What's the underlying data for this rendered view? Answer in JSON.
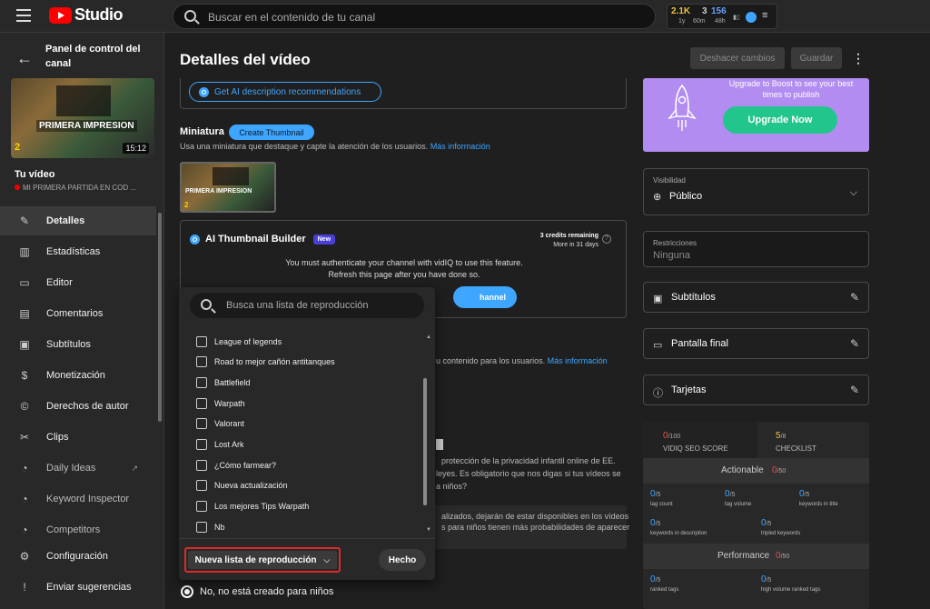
{
  "topbar": {
    "logo_text": "Studio",
    "search_placeholder": "Buscar en el contenido de tu canal",
    "vidiq": {
      "stat1_value": "2.1K",
      "stat1_sub": "1y",
      "stat2_value": "3",
      "stat2_sub": "60m",
      "stat3_value": "156",
      "stat3_sub": "48h"
    }
  },
  "sidebar": {
    "panel_title": "Panel de control del canal",
    "thumbnail": {
      "caption": "PRIMERA IMPRESION",
      "number": "2",
      "duration": "15:12"
    },
    "your_video_label": "Tu vídeo",
    "video_name": "MI PRIMERA PARTIDA EN COD ...",
    "items": [
      {
        "label": "Detalles",
        "icon": "pencil-icon"
      },
      {
        "label": "Estadísticas",
        "icon": "analytics-icon"
      },
      {
        "label": "Editor",
        "icon": "film-editor-icon"
      },
      {
        "label": "Comentarios",
        "icon": "comment-icon"
      },
      {
        "label": "Subtítulos",
        "icon": "subtitles-icon"
      },
      {
        "label": "Monetización",
        "icon": "dollar-icon"
      },
      {
        "label": "Derechos de autor",
        "icon": "copyright-icon"
      },
      {
        "label": "Clips",
        "icon": "scissors-icon"
      },
      {
        "label": "Daily Ideas",
        "icon": "vidiq-icon"
      },
      {
        "label": "Keyword Inspector",
        "icon": "vidiq-icon"
      },
      {
        "label": "Competitors",
        "icon": "vidiq-icon"
      },
      {
        "label": "Configuración",
        "icon": "gear-icon"
      },
      {
        "label": "Enviar sugerencias",
        "icon": "feedback-icon"
      }
    ]
  },
  "header": {
    "title": "Detalles del vídeo",
    "undo_label": "Deshacer cambios",
    "save_label": "Guardar"
  },
  "main": {
    "ai_description_button": "Get AI description recommendations",
    "miniatura_label": "Miniatura",
    "create_thumbnail_label": "Create Thumbnail",
    "miniatura_desc": "Usa una miniatura que destaque y capte la atención de los usuarios.",
    "more_info": "Más información",
    "thumb_caption": "PRIMERA IMPRESION",
    "thumb_number": "2",
    "builder": {
      "title": "AI Thumbnail Builder",
      "badge": "New",
      "credits_line1": "3 credits remaining",
      "credits_line2": "More in 31 days",
      "auth_line1": "You must authenticate your channel with vidIQ to use this feature.",
      "auth_line2": "Refresh this page after you have done so.",
      "auth_button_fragment": "hannel"
    },
    "bg_fragments": {
      "f1": "u contenido para los usuarios.",
      "f1_link": "Más información",
      "f2": "protección de la privacidad infantil online de EE.",
      "f3": "leyes. Es obligatorio que nos digas si tus vídeos se",
      "f3_link": "a niños?",
      "f4": "alizados, dejarán de estar disponibles en los vídeos",
      "f5": "s para niños tienen más probabilidades de aparecer"
    },
    "radio_not_for_kids": "No, no está creado para niños"
  },
  "playlist_dropdown": {
    "search_placeholder": "Busca una lista de reproducción",
    "items": [
      "League of legends",
      "Road to mejor cañón antitanques",
      "Battlefield",
      "Warpath",
      "Valorant",
      "Lost Ark",
      "¿Cómo farmear?",
      "Nueva actualización",
      "Los mejores Tips Warpath",
      "Nb"
    ],
    "new_playlist_label": "Nueva lista de reproducción",
    "done_label": "Hecho"
  },
  "right_panel": {
    "upgrade_text_line1": "Upgrade to Boost to see your best",
    "upgrade_text_line2": "times to publish",
    "upgrade_bold": "Boost",
    "upgrade_button": "Upgrade Now",
    "visibility_caption": "Visibilidad",
    "visibility_value": "Público",
    "restrictions_caption": "Restricciones",
    "restrictions_value": "Ninguna",
    "subtitles_label": "Subtítulos",
    "end_screen_label": "Pantalla final",
    "cards_label": "Tarjetas"
  },
  "seo": {
    "score_value": "0",
    "score_max": "/100",
    "score_label": "VIDIQ SEO SCORE",
    "checklist_value": "5",
    "checklist_max": "/8",
    "checklist_label": "CHECKLIST",
    "actionable_label": "Actionable",
    "actionable_value": "0",
    "actionable_max": "/50",
    "metrics_a": [
      {
        "value": "0",
        "max": "/5",
        "label": "tag count"
      },
      {
        "value": "0",
        "max": "/5",
        "label": "tag volume"
      },
      {
        "value": "0",
        "max": "/5",
        "label": "keywords in title"
      }
    ],
    "metrics_b": [
      {
        "value": "0",
        "max": "/5",
        "label": "keywords in description"
      },
      {
        "value": "0",
        "max": "/5",
        "label": "tripled keywords"
      }
    ],
    "performance_label": "Performance",
    "performance_value": "0",
    "performance_max": "/50",
    "metrics_c": [
      {
        "value": "0",
        "max": "/5",
        "label": "ranked tags"
      },
      {
        "value": "0",
        "max": "/5",
        "label": "high volume ranked tags"
      }
    ],
    "colors": {
      "red": "#e05050",
      "blue": "#3ea6ff",
      "yellow": "#f0c040"
    }
  }
}
